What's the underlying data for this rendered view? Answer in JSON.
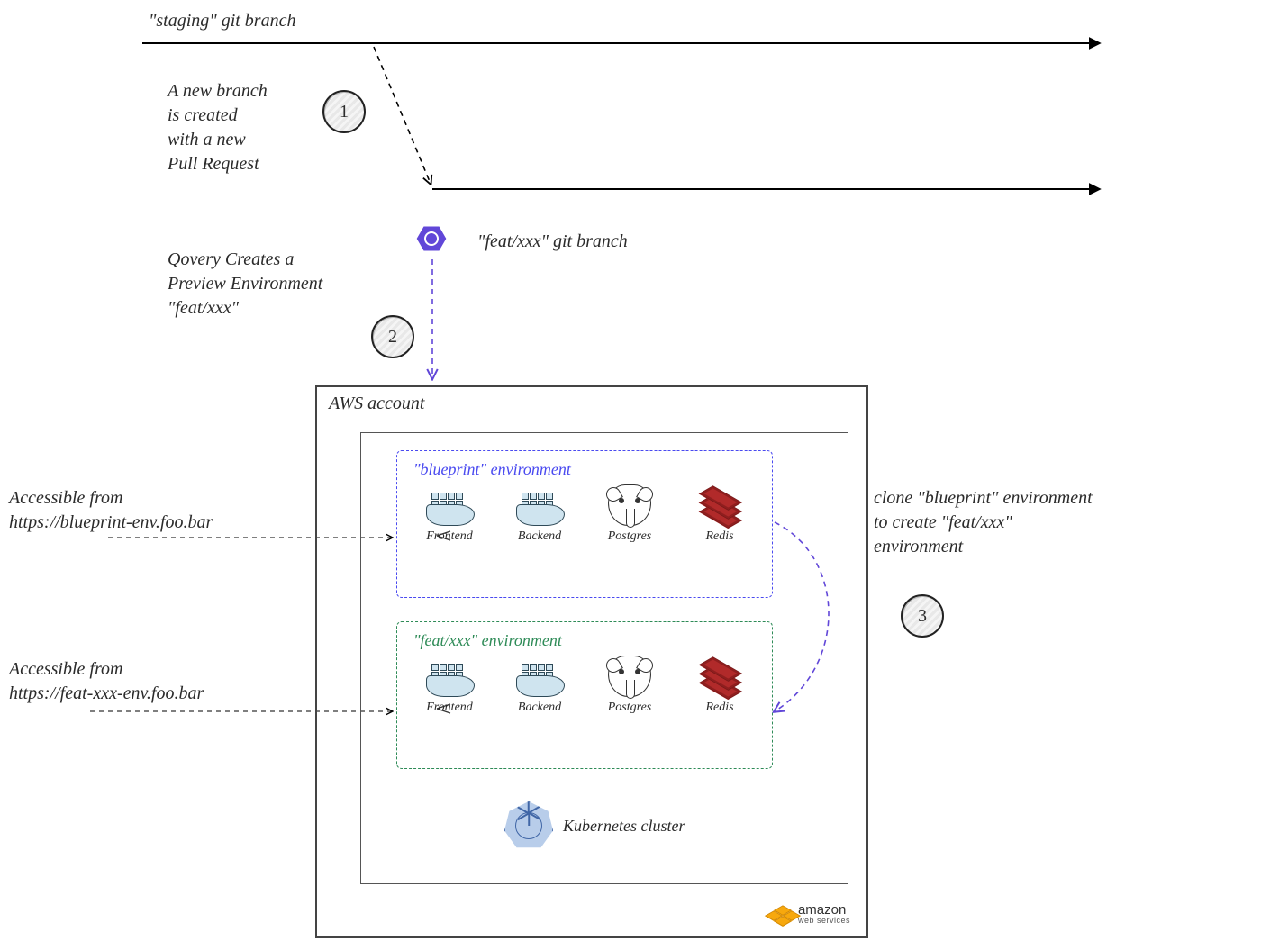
{
  "branches": {
    "staging_label": "\"staging\" git branch",
    "feat_label": "\"feat/xxx\" git branch"
  },
  "steps": {
    "one": {
      "num": "1",
      "text": "A new branch\nis created\nwith a new\nPull Request"
    },
    "two": {
      "num": "2",
      "text": "Qovery Creates a\nPreview Environment\n\"feat/xxx\""
    },
    "three": {
      "num": "3",
      "text": "clone \"blueprint\" environment\nto create \"feat/xxx\"\nenvironment"
    }
  },
  "aws": {
    "title": "AWS account",
    "logo_name": "amazon",
    "logo_sub": "web services"
  },
  "k8s": {
    "caption": "Kubernetes cluster"
  },
  "environments": {
    "blueprint": {
      "title": "\"blueprint\" environment",
      "color": "#4a4af0",
      "access_label": "Accessible from\nhttps://blueprint-env.foo.bar"
    },
    "feat": {
      "title": "\"feat/xxx\" environment",
      "color": "#2e8b57",
      "access_label": "Accessible from\nhttps://feat-xxx-env.foo.bar"
    }
  },
  "services": {
    "frontend": "Frontend",
    "backend": "Backend",
    "postgres": "Postgres",
    "redis": "Redis"
  }
}
